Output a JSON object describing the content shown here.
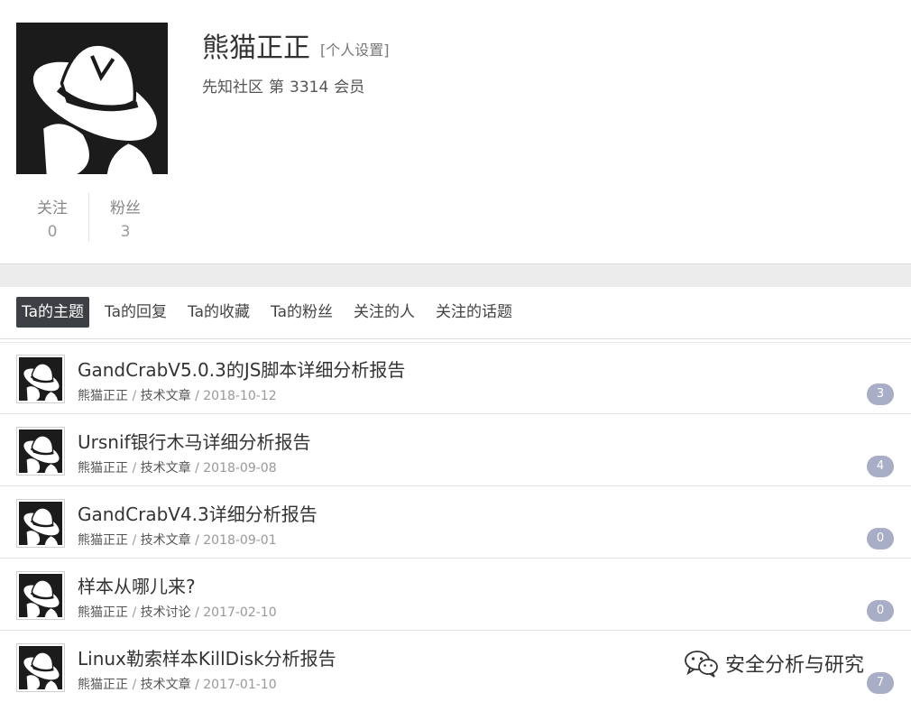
{
  "profile": {
    "name": "熊猫正正",
    "settings_link": "[个人设置]",
    "community": "先知社区",
    "rank_prefix": "第",
    "rank_number": "3314",
    "rank_suffix": "会员"
  },
  "stats": {
    "following_label": "关注",
    "following_value": "0",
    "followers_label": "粉丝",
    "followers_value": "3"
  },
  "tabs": [
    {
      "label": "Ta的主题"
    },
    {
      "label": "Ta的回复"
    },
    {
      "label": "Ta的收藏"
    },
    {
      "label": "Ta的粉丝"
    },
    {
      "label": "关注的人"
    },
    {
      "label": "关注的话题"
    }
  ],
  "topics": [
    {
      "title": "GandCrabV5.0.3的JS脚本详细分析报告",
      "author": "熊猫正正",
      "category": "技术文章",
      "date": "2018-10-12",
      "replies": "3"
    },
    {
      "title": "Ursnif银行木马详细分析报告",
      "author": "熊猫正正",
      "category": "技术文章",
      "date": "2018-09-08",
      "replies": "4"
    },
    {
      "title": "GandCrabV4.3详细分析报告",
      "author": "熊猫正正",
      "category": "技术文章",
      "date": "2018-09-01",
      "replies": "0"
    },
    {
      "title": "样本从哪儿来?",
      "author": "熊猫正正",
      "category": "技术讨论",
      "date": "2017-02-10",
      "replies": "0"
    },
    {
      "title": "Linux勒索样本KillDisk分析报告",
      "author": "熊猫正正",
      "category": "技术文章",
      "date": "2017-01-10",
      "replies": "7"
    }
  ],
  "separator": " / ",
  "watermark": {
    "text": "安全分析与研究",
    "icon": "wechat-icon"
  },
  "colors": {
    "tab_active_bg": "#3c3f43",
    "badge_bg": "#a8aec6",
    "band_bg": "#ececec"
  }
}
